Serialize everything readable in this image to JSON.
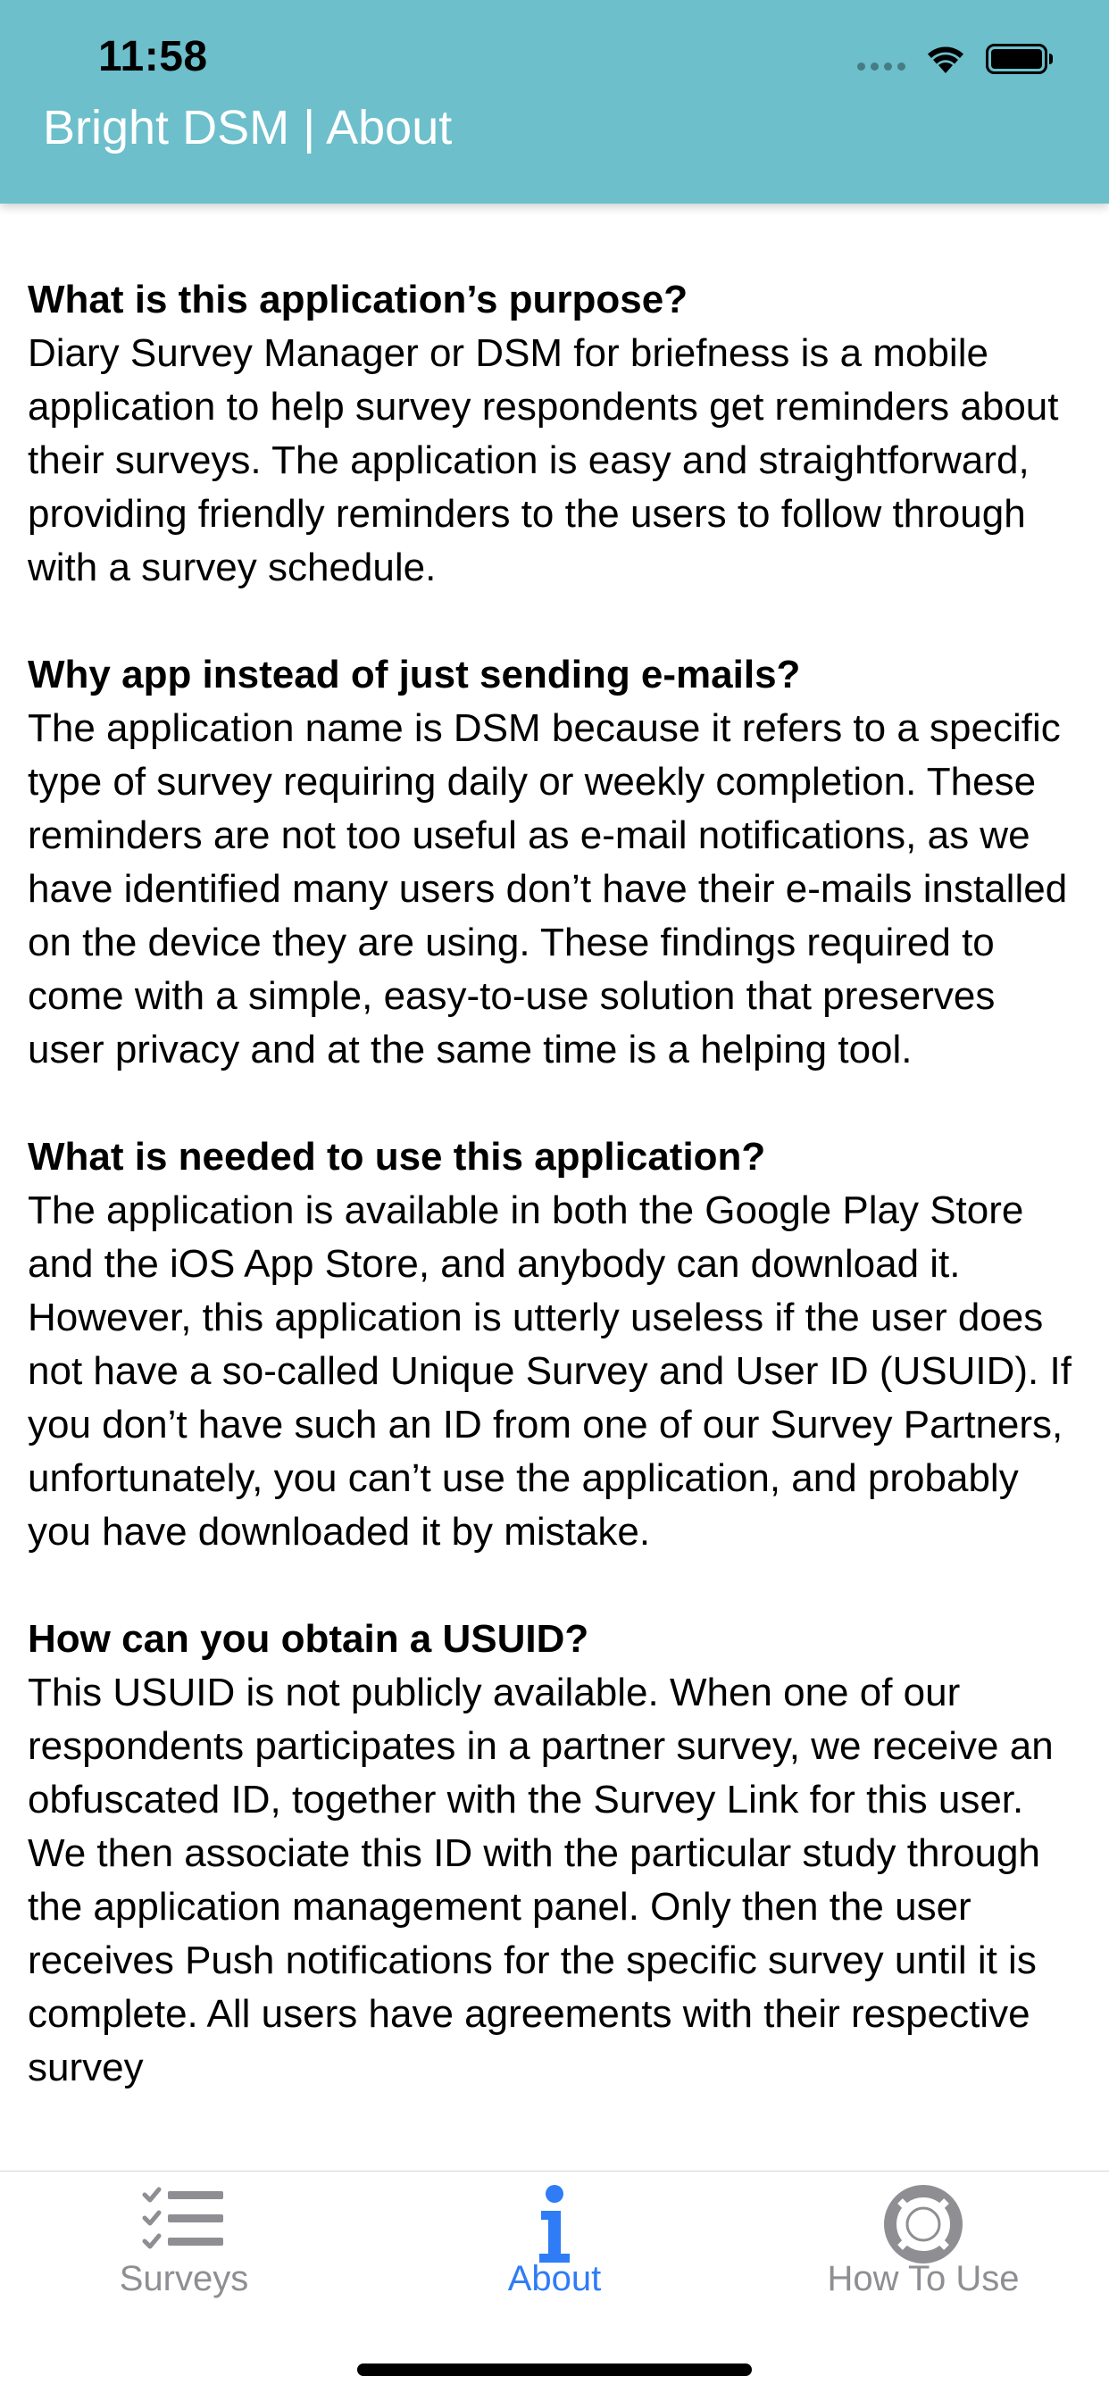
{
  "status_bar": {
    "time": "11:58"
  },
  "header": {
    "title": "Bright DSM | About"
  },
  "sections": [
    {
      "heading": "What is this application’s purpose?",
      "body": "Diary Survey Manager or DSM for briefness is a mobile application to help survey respondents get reminders about their surveys. The application is easy and straightforward, providing friendly reminders to the users to follow through with a survey schedule."
    },
    {
      "heading": "Why app instead of just sending e-mails?",
      "body": "The application name is DSM because it refers to a specific type of survey requiring daily or weekly completion. These reminders are not too useful as e-mail notifications, as we have identified many users don’t have their e-mails installed on the device they are using. These findings required to come with a simple, easy-to-use solution that preserves user privacy and at the same time is a helping tool."
    },
    {
      "heading": "What is needed to use this application?",
      "body": "The application is available in both the Google Play Store and the iOS App Store, and anybody can download it. However, this application is utterly useless if the user does not have a so-called Unique Survey and User ID (USUID). If you don’t have such an ID from one of our Survey Partners, unfortunately, you can’t use the application, and probably you have downloaded it by mistake."
    },
    {
      "heading": "How can you obtain a USUID?",
      "body": "This USUID is not publicly available. When one of our respondents participates in a partner survey, we receive an obfuscated ID, together with the Survey Link for this user. We then associate this ID with the particular study through the application management panel. Only then the user receives Push notifications for the specific survey until it is complete. All users have agreements with their respective survey"
    }
  ],
  "tabs": [
    {
      "label": "Surveys",
      "icon": "checklist-icon",
      "active": false
    },
    {
      "label": "About",
      "icon": "info-icon",
      "active": true
    },
    {
      "label": "How To Use",
      "icon": "lifebuoy-icon",
      "active": false
    }
  ],
  "colors": {
    "header_bg": "#6cbfcb",
    "tab_active": "#2f7cf6",
    "tab_inactive": "#8e8e93"
  }
}
